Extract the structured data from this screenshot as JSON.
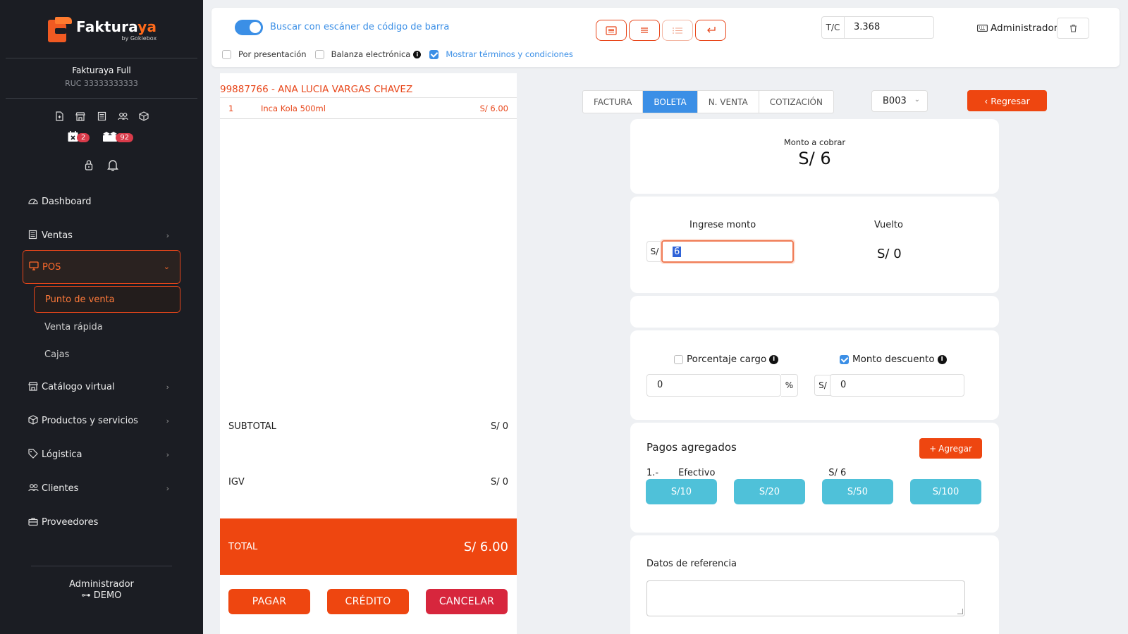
{
  "sidebar": {
    "brand": {
      "name_main": "Faktura",
      "name_accent": "ya",
      "tagline": "by Gokiebox"
    },
    "company": {
      "name": "Fakturaya Full",
      "ruc": "RUC 33333333333"
    },
    "quick_icons": [
      "new-document-icon",
      "store-icon",
      "list-icon",
      "users-icon",
      "box-icon"
    ],
    "badges": [
      {
        "icon": "calendar-x-icon",
        "count": "2"
      },
      {
        "icon": "boxes-icon",
        "count": "92"
      }
    ],
    "menu": [
      {
        "label": "Dashboard",
        "icon": "dashboard-icon",
        "chevron": false
      },
      {
        "label": "Ventas",
        "icon": "receipt-icon",
        "chevron": true
      },
      {
        "label": "POS",
        "icon": "monitor-icon",
        "chevron": true,
        "active": true
      },
      {
        "label": "Catálogo virtual",
        "icon": "store-icon",
        "chevron": true
      },
      {
        "label": "Productos y servicios",
        "icon": "box-icon",
        "chevron": true
      },
      {
        "label": "Lógistica",
        "icon": "tag-icon",
        "chevron": true
      },
      {
        "label": "Clientes",
        "icon": "users-icon",
        "chevron": true
      },
      {
        "label": "Proveedores",
        "icon": "briefcase-icon",
        "chevron": false
      }
    ],
    "submenu": [
      {
        "label": "Punto de venta",
        "active": true
      },
      {
        "label": "Venta rápida"
      },
      {
        "label": "Cajas"
      }
    ],
    "user": {
      "name": "Administrador",
      "env": "DEMO"
    }
  },
  "topbar": {
    "barcode_toggle": {
      "on": true,
      "label": "Buscar con escáner de código de barra"
    },
    "checks": [
      {
        "label": "Por presentación",
        "checked": false
      },
      {
        "label": "Balanza electrónica",
        "checked": false,
        "info": true
      },
      {
        "label": "Mostrar términos y condiciones",
        "checked": true
      }
    ],
    "tc_label": "T/C",
    "tc_value": "3.368",
    "user_label": "Administrador"
  },
  "ticket": {
    "customer": "99887766 - ANA LUCIA VARGAS CHAVEZ",
    "items": [
      {
        "qty": "1",
        "name": "Inca Kola 500ml",
        "price": "S/ 6.00"
      }
    ],
    "subtotal_label": "SUBTOTAL",
    "subtotal_value": "S/ 0",
    "igv_label": "IGV",
    "igv_value": "S/ 0",
    "total_label": "TOTAL",
    "total_value": "S/ 6.00",
    "actions": {
      "pay": "PAGAR",
      "credit": "CRÉDITO",
      "cancel": "CANCELAR"
    }
  },
  "doc_types": [
    {
      "label": "FACTURA"
    },
    {
      "label": "BOLETA",
      "active": true
    },
    {
      "label": "N. VENTA"
    },
    {
      "label": "COTIZACIÓN"
    }
  ],
  "series": "B003",
  "back_label": "Regresar",
  "payment": {
    "amount_label": "Monto a cobrar",
    "amount_value": "S/ 6",
    "input_label": "Ingrese monto",
    "currency": "S/",
    "input_value": "6",
    "change_label": "Vuelto",
    "change_value": "S/ 0",
    "charge_pct_label": "Porcentaje cargo",
    "charge_pct_checked": false,
    "charge_pct_value": "0",
    "pct_suffix": "%",
    "discount_label": "Monto descuento",
    "discount_checked": true,
    "discount_value": "0",
    "payments_title": "Pagos agregados",
    "add_label": "Agregar",
    "payments": [
      {
        "index": "1.-",
        "method": "Efectivo",
        "amount": "S/ 6"
      }
    ],
    "quick_amounts": [
      "S/10",
      "S/20",
      "S/50",
      "S/100"
    ],
    "reference_label": "Datos de referencia"
  },
  "colors": {
    "accent": "#ee4610",
    "primary": "#3b8fe6",
    "quick": "#4fc1d9",
    "sidebar": "#1b1d23"
  }
}
